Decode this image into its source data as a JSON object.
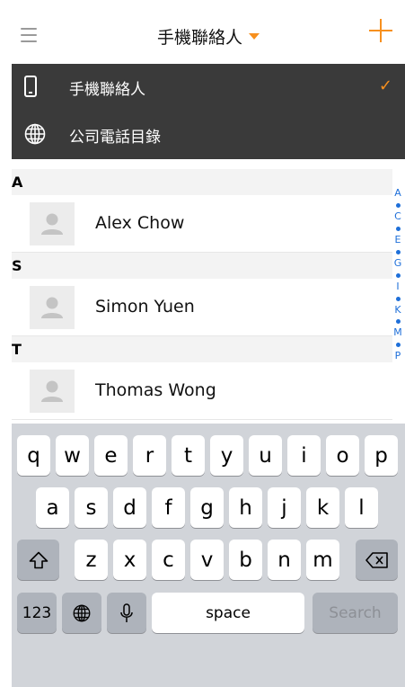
{
  "header": {
    "title": "手機聯絡人"
  },
  "dropdown": {
    "items": [
      {
        "label": "手機聯絡人",
        "icon": "phone-icon",
        "selected": true,
        "check": "✓"
      },
      {
        "label": "公司電話目錄",
        "icon": "globe-icon",
        "selected": false
      }
    ]
  },
  "contacts": [
    {
      "letter": "A",
      "name": "Alex Chow"
    },
    {
      "letter": "S",
      "name": "Simon Yuen"
    },
    {
      "letter": "T",
      "name": "Thomas Wong"
    }
  ],
  "index": [
    "A",
    "C",
    "E",
    "G",
    "I",
    "K",
    "M",
    "P"
  ],
  "keyboard": {
    "row1": [
      "q",
      "w",
      "e",
      "r",
      "t",
      "y",
      "u",
      "i",
      "o",
      "p"
    ],
    "row2": [
      "a",
      "s",
      "d",
      "f",
      "g",
      "h",
      "j",
      "k",
      "l"
    ],
    "row3": [
      "z",
      "x",
      "c",
      "v",
      "b",
      "n",
      "m"
    ],
    "numbers_label": "123",
    "space_label": "space",
    "search_label": "Search"
  },
  "colors": {
    "accent": "#f7901e",
    "dropdown_bg": "#3a3a3a",
    "index_blue": "#1e6fd9",
    "keyboard_bg": "#d1d4d9"
  }
}
